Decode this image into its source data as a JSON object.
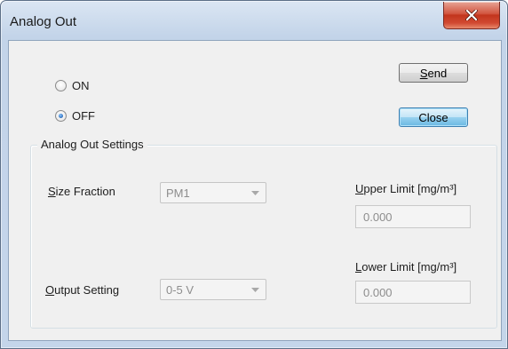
{
  "window": {
    "title": "Analog Out"
  },
  "power": {
    "on_label": "ON",
    "off_label": "OFF",
    "selected": "OFF"
  },
  "buttons": {
    "send_mnemonic": "S",
    "send_rest": "end",
    "close_label": "Close"
  },
  "settings": {
    "group_label": "Analog Out Settings",
    "size_fraction": {
      "label_mnemonic": "S",
      "label_rest": "ize Fraction",
      "value": "PM1"
    },
    "output_setting": {
      "label_mnemonic": "O",
      "label_rest": "utput Setting",
      "value": "0-5 V"
    },
    "upper_limit": {
      "label_mnemonic": "U",
      "label_rest": "pper Limit [mg/m³]",
      "value": "0.000"
    },
    "lower_limit": {
      "label_mnemonic": "L",
      "label_rest": "ower Limit [mg/m³]",
      "value": "0.000"
    }
  },
  "icons": {
    "close": "close-icon",
    "dropdown": "chevron-down-icon"
  }
}
